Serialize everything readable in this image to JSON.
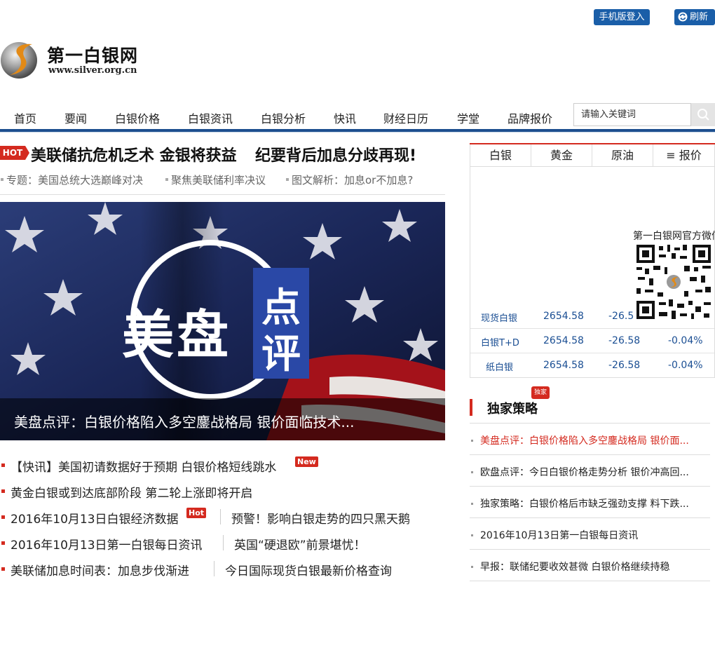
{
  "header": {
    "mobile_login": "手机版登入",
    "refresh": "刷新",
    "logo_title": "第一白银网",
    "logo_url": "www.silver.org.cn"
  },
  "nav": {
    "items": [
      "首页",
      "要闻",
      "白银价格",
      "白银资讯",
      "白银分析",
      "快讯",
      "财经日历",
      "学堂",
      "品牌报价"
    ],
    "search_placeholder": "请输入关键词"
  },
  "headline": {
    "badge": "HOT",
    "main_left": "美联储抗危机乏术 金银将获益",
    "main_right": "纪要背后加息分歧再现!",
    "sub_links": [
      "专题：美国总统大选巅峰对决",
      "聚焦美联储利率决议",
      "图文解析：加息or不加息?"
    ]
  },
  "hero": {
    "art_text_left": "美盘",
    "art_text_right_1": "点",
    "art_text_right_2": "评",
    "caption": "美盘点评：白银价格陷入多空鏖战格局 银价面临技术..."
  },
  "news": [
    {
      "left": "【快讯】美国初请数据好于预期 白银价格短线跳水",
      "tag": "New"
    },
    {
      "left": "黄金白银或到达底部阶段 第二轮上涨即将开启"
    },
    {
      "left": "2016年10月13日白银经济数据",
      "tag": "Hot",
      "right": "预警！影响白银走势的四只黑天鹅"
    },
    {
      "left": "2016年10月13日第一白银每日资讯",
      "right": "英国“硬退欧”前景堪忧！"
    },
    {
      "left": "美联储加息时间表：加息步伐渐进",
      "right": "今日国际现货白银最新价格查询"
    }
  ],
  "prices": {
    "tabs": [
      "白银",
      "黄金",
      "原油",
      "≡ 报价"
    ],
    "qr_title": "第一白银网官方微信",
    "rows": [
      {
        "name": "现货白银",
        "price": "2654.58",
        "change": "-26.5",
        "pct": ""
      },
      {
        "name": "白银T+D",
        "price": "2654.58",
        "change": "-26.58",
        "pct": "-0.04%"
      },
      {
        "name": "纸白银",
        "price": "2654.58",
        "change": "-26.58",
        "pct": "-0.04%"
      }
    ]
  },
  "exclusive": {
    "title": "独家策略",
    "badge": "独家",
    "items": [
      "美盘点评：白银价格陷入多空鏖战格局 银价面...",
      "欧盘点评：今日白银价格走势分析 银价冲高回...",
      "独家策略：白银价格后市缺乏强劲支撑 料下跌...",
      "2016年10月13日第一白银每日资讯",
      "早报：联储纪要收效甚微 白银价格继续持稳"
    ]
  },
  "colors": {
    "brand_blue": "#1d4f8f",
    "accent_red": "#d42a1f"
  }
}
